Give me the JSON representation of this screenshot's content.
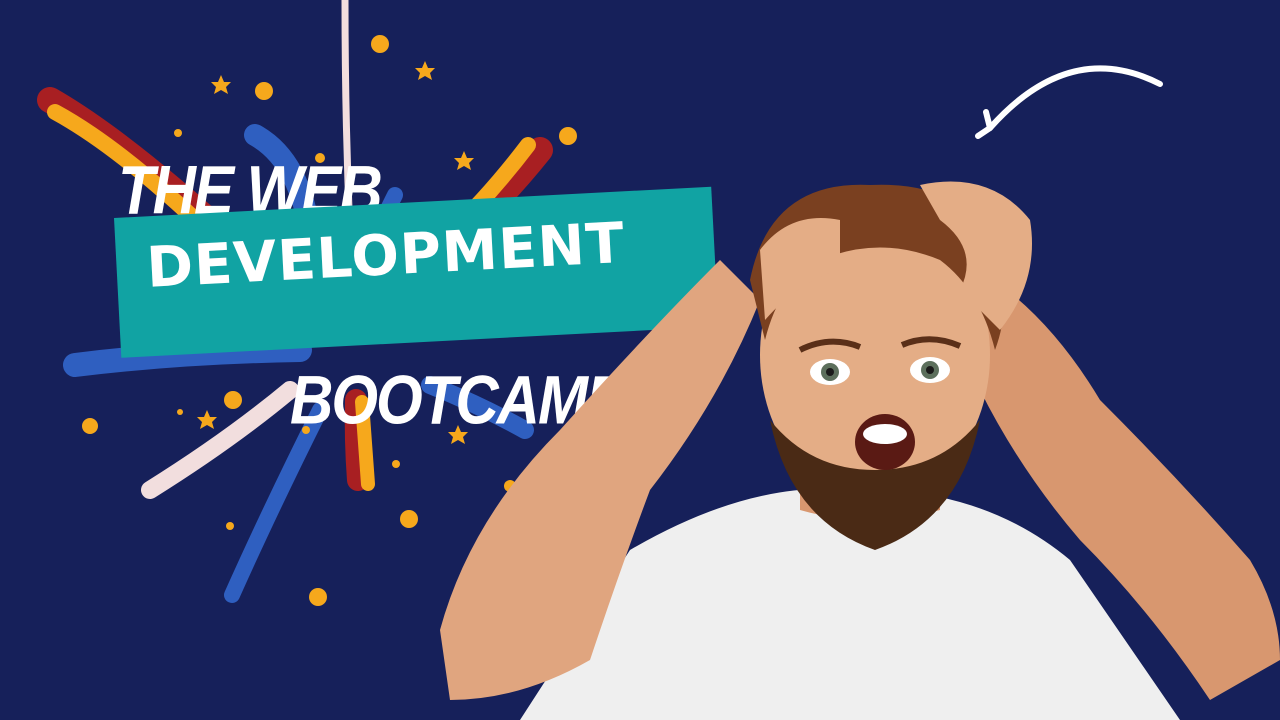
{
  "thumbnail": {
    "title_line_1": "THE WEB",
    "title_line_2": "DEVELOPMENT",
    "title_line_3": "BOOTCAMP"
  },
  "colors": {
    "background": "#16205a",
    "banner": "#11a3a3",
    "text": "#ffffff",
    "accent_yellow": "#f6a81c",
    "accent_red": "#a81f22",
    "accent_blue": "#2f5fc0",
    "accent_pink": "#f2dede",
    "shirt": "#efefef",
    "skin": "#e0a57f",
    "hair": "#7a4020",
    "beard": "#4a2a15"
  },
  "icons": [
    "curved-arrow-icon",
    "star-icon",
    "confetti-dot"
  ]
}
